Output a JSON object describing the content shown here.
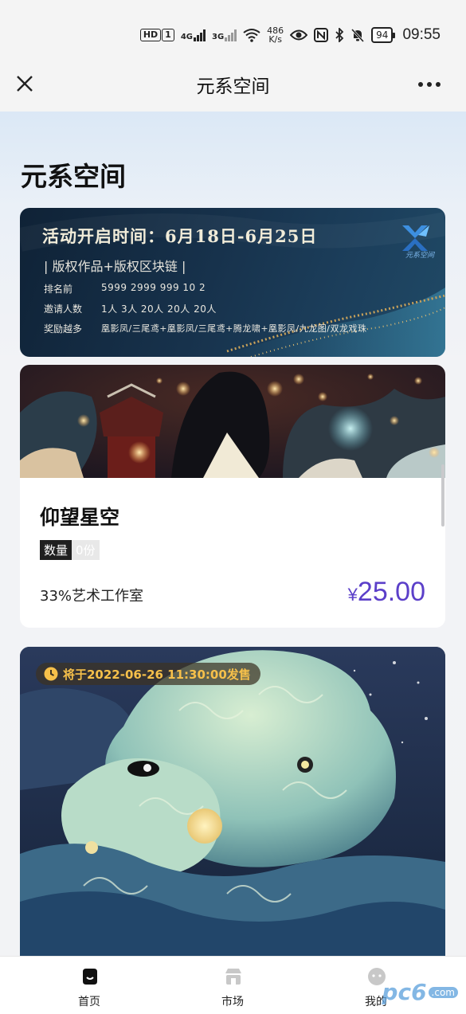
{
  "status_bar": {
    "hd": "HD",
    "hd_sub": "1",
    "net1": "4G",
    "net2": "3G",
    "speed_value": "486",
    "speed_unit": "K/s",
    "battery": "94",
    "time": "09:55"
  },
  "nav": {
    "title": "元系空间"
  },
  "page": {
    "title": "元系空间"
  },
  "banner": {
    "heading": "活动开启时间：6月18日-6月25日",
    "subtitle": "| 版权作品+版权区块链 |",
    "rows": [
      {
        "key": "排名前",
        "value": "5999  2999  999  10    2"
      },
      {
        "key": "邀请人数",
        "value": "1人   3人   20人   20人   20人"
      },
      {
        "key": "奖励越多",
        "value": "凰影凤/三尾鸢+凰影凤/三尾鸢+腾龙啸+凰影凤/九龙图/双龙戏珠"
      }
    ],
    "logo_text": "元系空间"
  },
  "card1": {
    "name": "仰望星空",
    "qty_label": "数量",
    "qty_value": "0份",
    "studio": "33%艺术工作室",
    "currency": "¥",
    "price": "25.00"
  },
  "card2": {
    "sale_text": "将于2022-06-26 11:30:00发售"
  },
  "tabs": [
    {
      "label": "首页",
      "icon": "home-icon",
      "active": true
    },
    {
      "label": "市场",
      "icon": "market-icon",
      "active": false
    },
    {
      "label": "我的",
      "icon": "profile-icon",
      "active": false
    }
  ],
  "watermark": {
    "text": "pc6",
    "sub": ".com"
  },
  "colors": {
    "price": "#5b3fc9",
    "sale_tag": "#f6c04a",
    "banner_bg": "#17324c"
  }
}
